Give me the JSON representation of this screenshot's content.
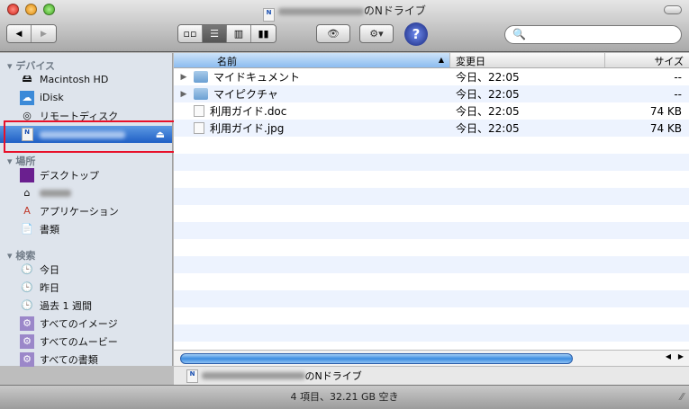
{
  "window": {
    "title_suffix": "のNドライブ"
  },
  "toolbar": {
    "back": "◀",
    "forward": "▶",
    "views": [
      "icon-view",
      "list-view",
      "column-view",
      "coverflow-view"
    ],
    "quicklook": "👁",
    "action": "⚙▾",
    "help": "?",
    "search_placeholder": ""
  },
  "sidebar": {
    "devices_header": "デバイス",
    "devices": [
      "Macintosh HD",
      "iDisk",
      "リモートディスク"
    ],
    "eject": "⏏",
    "places_header": "場所",
    "places": [
      "デスクトップ",
      "",
      "アプリケーション",
      "書類"
    ],
    "search_header": "検索",
    "searches": [
      "今日",
      "昨日",
      "過去 1 週間",
      "すべてのイメージ",
      "すべてのムービー",
      "すべての書類"
    ]
  },
  "list": {
    "columns": {
      "name": "名前",
      "date": "変更日",
      "size": "サイズ"
    },
    "rows": [
      {
        "name": "マイドキュメント",
        "date": "今日、22:05",
        "size": "--"
      },
      {
        "name": "マイピクチャ",
        "date": "今日、22:05",
        "size": "--"
      },
      {
        "name": "利用ガイド.doc",
        "date": "今日、22:05",
        "size": "74 KB"
      },
      {
        "name": "利用ガイド.jpg",
        "date": "今日、22:05",
        "size": "74 KB"
      }
    ]
  },
  "pathbar": {
    "suffix": "のNドライブ"
  },
  "status": {
    "text": "4 項目、32.21 GB 空き"
  },
  "colors": {
    "accent": "#1f5fc5",
    "highlight": "#e8102a"
  }
}
